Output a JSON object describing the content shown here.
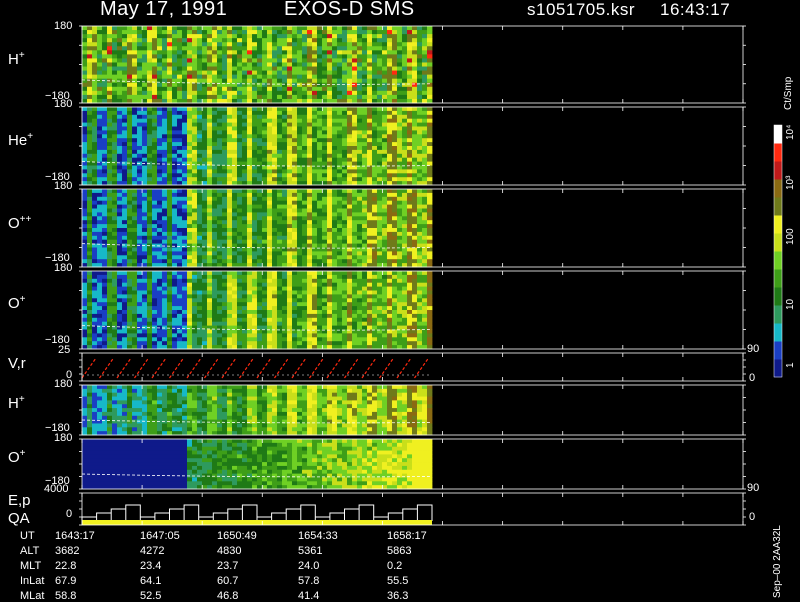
{
  "header": {
    "date": "May 17, 1991",
    "instrument": "EXOS-D SMS",
    "file": "s1051705.ksr",
    "time": "16:43:17"
  },
  "colors": {
    "palette": [
      "#0f1a8a",
      "#1a3fc4",
      "#17b8c8",
      "#2e9a5e",
      "#1f7a16",
      "#3e9e18",
      "#6fd024",
      "#c9df1a",
      "#f0f020",
      "#6f7a1a",
      "#8a6a12",
      "#c01a1a",
      "#ff2a10",
      "#ffffff"
    ]
  },
  "chart_data": [
    {
      "type": "heatmap",
      "ion": "H",
      "charge": "+",
      "ylim": [
        -180,
        180
      ],
      "ticklabels": [
        "180",
        "−180"
      ]
    },
    {
      "type": "heatmap",
      "ion": "He",
      "charge": "+",
      "ylim": [
        -180,
        180
      ],
      "ticklabels": [
        "180",
        "−180"
      ]
    },
    {
      "type": "heatmap",
      "ion": "O",
      "charge": "++",
      "ylim": [
        -180,
        180
      ],
      "ticklabels": [
        "180",
        "−180"
      ]
    },
    {
      "type": "heatmap",
      "ion": "O",
      "charge": "+",
      "ylim": [
        -180,
        180
      ],
      "ticklabels": [
        "180",
        "−180"
      ]
    },
    {
      "type": "line",
      "label": "V,r",
      "ylim": [
        0,
        25
      ],
      "ticklabels": [
        "25",
        "0"
      ],
      "right_ticklabels": [
        "90",
        "0"
      ]
    },
    {
      "type": "heatmap",
      "ion": "H",
      "charge": "+",
      "ylim": [
        -180,
        180
      ],
      "ticklabels": [
        "180",
        "−180"
      ]
    },
    {
      "type": "heatmap",
      "ion": "O",
      "charge": "+",
      "ylim": [
        -180,
        180
      ],
      "ticklabels": [
        "180",
        "−180"
      ]
    },
    {
      "type": "line",
      "label": "E,p",
      "label2": "QA",
      "ylim": [
        0,
        4000
      ],
      "ticklabels": [
        "4000",
        "0"
      ],
      "right_ticklabels": [
        "90",
        "0"
      ]
    }
  ],
  "colorbar": {
    "unit": "Ct/Smp",
    "labels": [
      "10⁴",
      "10³",
      "100",
      "10",
      "1"
    ]
  },
  "footer": {
    "rows": [
      {
        "label": "UT",
        "values": [
          "1643:17",
          "1647:05",
          "1650:49",
          "1654:33",
          "1658:17"
        ]
      },
      {
        "label": "ALT",
        "values": [
          "3682",
          "4272",
          "4830",
          "5361",
          "5863"
        ]
      },
      {
        "label": "MLT",
        "values": [
          "22.8",
          "23.4",
          "23.7",
          "24.0",
          "0.2"
        ]
      },
      {
        "label": "InLat",
        "values": [
          "67.9",
          "64.1",
          "60.7",
          "57.8",
          "55.5"
        ]
      },
      {
        "label": "MLat",
        "values": [
          "58.8",
          "52.5",
          "46.8",
          "41.4",
          "36.3"
        ]
      }
    ]
  },
  "side_text": "Sep–00 2AA32L"
}
